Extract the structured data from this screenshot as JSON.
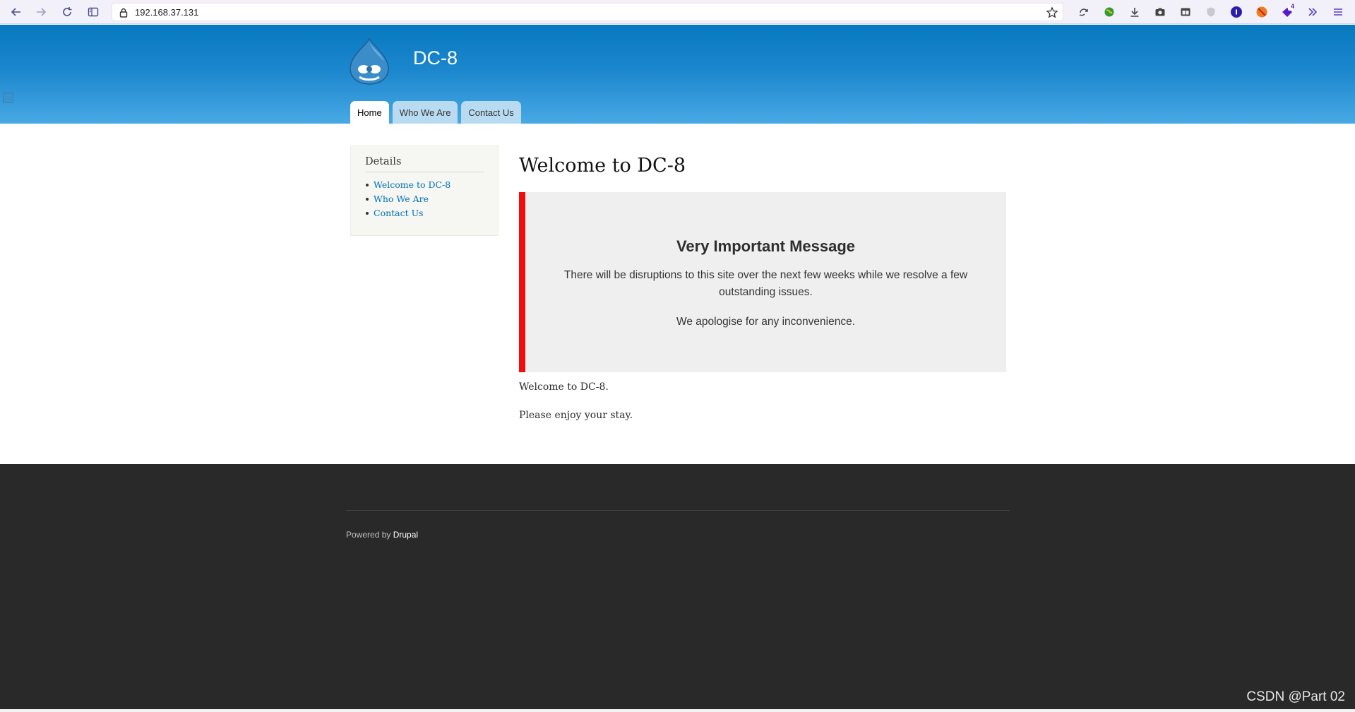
{
  "browser": {
    "url": "192.168.37.131",
    "icons": [
      "back-icon",
      "forward-icon",
      "reload-icon",
      "sidebar-icon",
      "lock-icon",
      "star-icon",
      "sync-icon",
      "globe-extension-icon",
      "download-icon",
      "screenshot-icon",
      "container-icon",
      "shield-icon",
      "onepassword-icon",
      "blocker-icon",
      "badge-extension-icon",
      "more-tools-icon",
      "menu-icon"
    ],
    "ext_badge_count": "4"
  },
  "site": {
    "name": "DC-8",
    "tabs": [
      {
        "label": "Home",
        "active": true
      },
      {
        "label": "Who We Are",
        "active": false
      },
      {
        "label": "Contact Us",
        "active": false
      }
    ]
  },
  "sidebar": {
    "title": "Details",
    "items": [
      {
        "label": "Welcome to DC-8"
      },
      {
        "label": "Who We Are"
      },
      {
        "label": "Contact Us"
      }
    ]
  },
  "main": {
    "title": "Welcome to DC-8",
    "message": {
      "heading": "Very Important Message",
      "line1": "There will be disruptions to this site over the next few weeks while we resolve a few outstanding issues.",
      "line2": "We apologise for any inconvenience."
    },
    "paragraphs": [
      "Welcome to DC-8.",
      "Please enjoy your stay."
    ]
  },
  "footer": {
    "powered_prefix": "Powered by ",
    "powered_link": "Drupal",
    "watermark": "CSDN @Part 02"
  },
  "colors": {
    "header_top": "#0779bf",
    "header_bottom": "#48a9e4",
    "alert_border": "#f20d0d",
    "link": "#0071b3",
    "footer_bg": "#292929"
  }
}
